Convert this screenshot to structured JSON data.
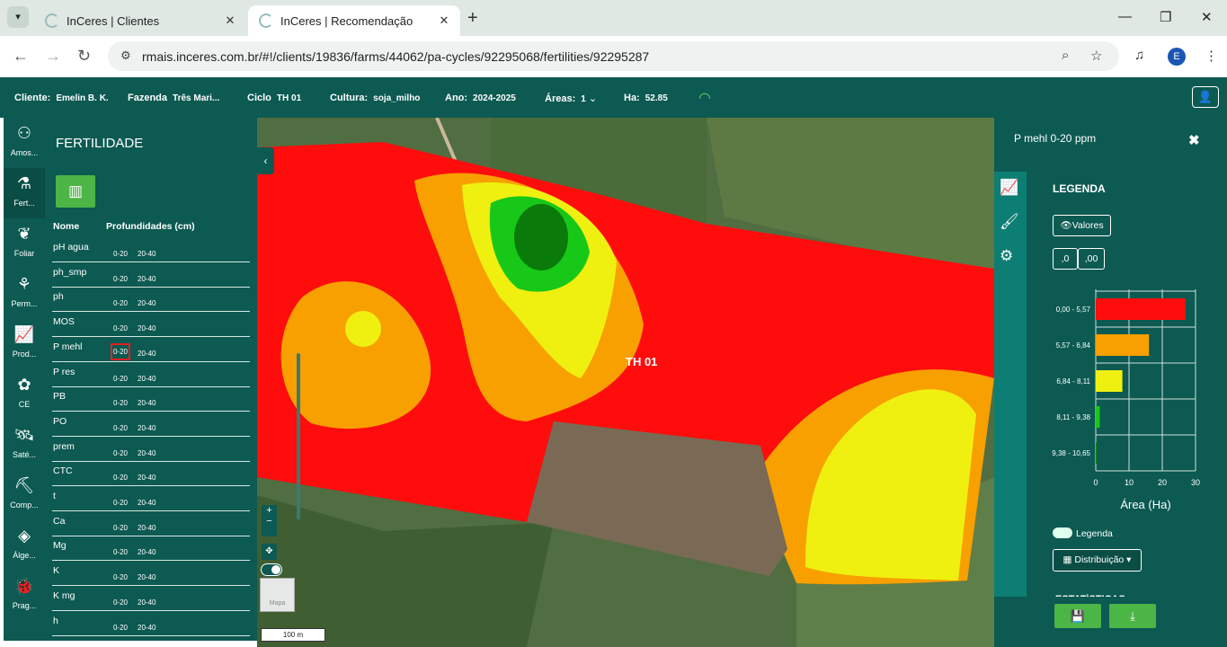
{
  "browser": {
    "tabs": [
      {
        "title": "InCeres | Clientes",
        "active": false
      },
      {
        "title": "InCeres | Recomendação",
        "active": true
      }
    ],
    "url": "rmais.inceres.com.br/#!/clients/19836/farms/44062/pa-cycles/92295068/fertilities/92295287",
    "profile_initial": "E"
  },
  "appbar": {
    "client_label": "Cliente:",
    "client_value": "Emelin B. K.",
    "farm_label": "Fazenda",
    "farm_value": "Três Mari...",
    "cycle_label": "Ciclo",
    "cycle_value": "TH 01",
    "crop_label": "Cultura:",
    "crop_value": "soja_milho",
    "year_label": "Ano:",
    "year_value": "2024-2025",
    "areas_label": "Áreas:",
    "areas_value": "1",
    "ha_label": "Ha:",
    "ha_value": "52.85"
  },
  "iconbar": [
    {
      "label": "Amos...",
      "icon": "samples-icon"
    },
    {
      "label": "Fert...",
      "icon": "fertility-icon",
      "selected": true
    },
    {
      "label": "Foliar",
      "icon": "leaf-icon"
    },
    {
      "label": "Perm...",
      "icon": "permanent-crop-icon"
    },
    {
      "label": "Prod...",
      "icon": "productivity-chart-icon"
    },
    {
      "label": "CE",
      "icon": "conductivity-plant-icon"
    },
    {
      "label": "Saté...",
      "icon": "satellite-icon"
    },
    {
      "label": "Comp...",
      "icon": "compaction-icon"
    },
    {
      "label": "Álge...",
      "icon": "layers-icon"
    },
    {
      "label": "Prag...",
      "icon": "bug-icon"
    }
  ],
  "fertility": {
    "title": "FERTILIDADE",
    "col_name": "Nome",
    "col_depths": "Profundidades (cm)",
    "rows": [
      {
        "name": "pH agua",
        "d1": "0-20",
        "d2": "20-40"
      },
      {
        "name": "ph_smp",
        "d1": "0-20",
        "d2": "20-40"
      },
      {
        "name": "ph",
        "d1": "0-20",
        "d2": "20-40"
      },
      {
        "name": "MOS",
        "d1": "0-20",
        "d2": "20-40"
      },
      {
        "name": "P mehl",
        "d1": "0-20",
        "d2": "20-40",
        "highlight": true
      },
      {
        "name": "P res",
        "d1": "0-20",
        "d2": "20-40"
      },
      {
        "name": "PB",
        "d1": "0-20",
        "d2": "20-40"
      },
      {
        "name": "PO",
        "d1": "0-20",
        "d2": "20-40"
      },
      {
        "name": "prem",
        "d1": "0-20",
        "d2": "20-40"
      },
      {
        "name": "CTC",
        "d1": "0-20",
        "d2": "20-40"
      },
      {
        "name": "t",
        "d1": "0-20",
        "d2": "20-40"
      },
      {
        "name": "Ca",
        "d1": "0-20",
        "d2": "20-40"
      },
      {
        "name": "Mg",
        "d1": "0-20",
        "d2": "20-40"
      },
      {
        "name": "K",
        "d1": "0-20",
        "d2": "20-40"
      },
      {
        "name": "K mg",
        "d1": "0-20",
        "d2": "20-40"
      },
      {
        "name": "h",
        "d1": "0-20",
        "d2": "20-40"
      }
    ]
  },
  "map": {
    "field_label": "TH 01",
    "scale": "100 m",
    "minimap_label": "Mapa"
  },
  "legend_panel": {
    "title": "P mehl 0-20 ppm",
    "legend_title": "LEGENDA",
    "values_button": "Valores",
    "decimal_left": ",0",
    "decimal_right": ",00",
    "toggle_label": "Legenda",
    "distribution_button": "Distribuição",
    "cut_text": "ESTATÍSTICAS"
  },
  "chart_data": {
    "type": "bar",
    "orientation": "horizontal",
    "categories": [
      "0,00 - 5,57",
      "5,57 - 6,84",
      "6,84 - 8,11",
      "8,11 - 9,38",
      "9,38 - 10,65"
    ],
    "values": [
      27,
      16,
      8,
      1.2,
      0.3
    ],
    "colors": [
      "#ff0d0d",
      "#f7a000",
      "#f0f010",
      "#18c818",
      "#0a8a0a"
    ],
    "xlabel": "Área (Ha)",
    "xticks": [
      "0",
      "10",
      "20",
      "30"
    ],
    "xlim": [
      0,
      30
    ]
  }
}
